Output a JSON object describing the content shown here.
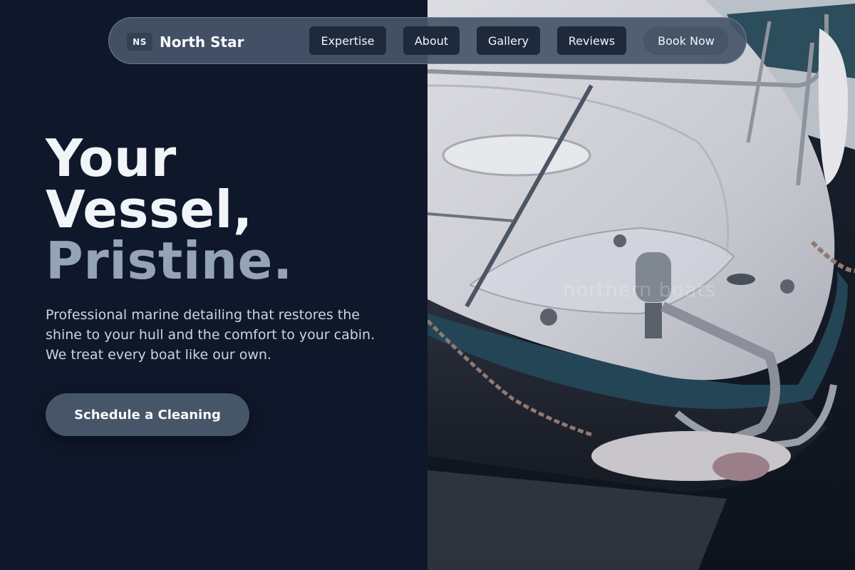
{
  "brand": {
    "badge": "NS",
    "name": "North Star"
  },
  "nav": {
    "items": [
      {
        "label": "Expertise"
      },
      {
        "label": "About"
      },
      {
        "label": "Gallery"
      },
      {
        "label": "Reviews"
      }
    ],
    "cta_label": "Book Now"
  },
  "hero": {
    "title_line1": "Your",
    "title_line2": "Vessel,",
    "title_line3": "Pristine.",
    "description": "Professional marine detailing that restores the shine to your hull and the comfort to your cabin. We treat every boat like our own.",
    "cta_label": "Schedule a Cleaning"
  },
  "photo": {
    "subject": "boat-bow-photo",
    "watermark": "northern boats"
  },
  "colors": {
    "background": "#0f172a",
    "accent": "#475569",
    "nav_button": "#1e293b",
    "muted_text": "#94a3b8"
  }
}
